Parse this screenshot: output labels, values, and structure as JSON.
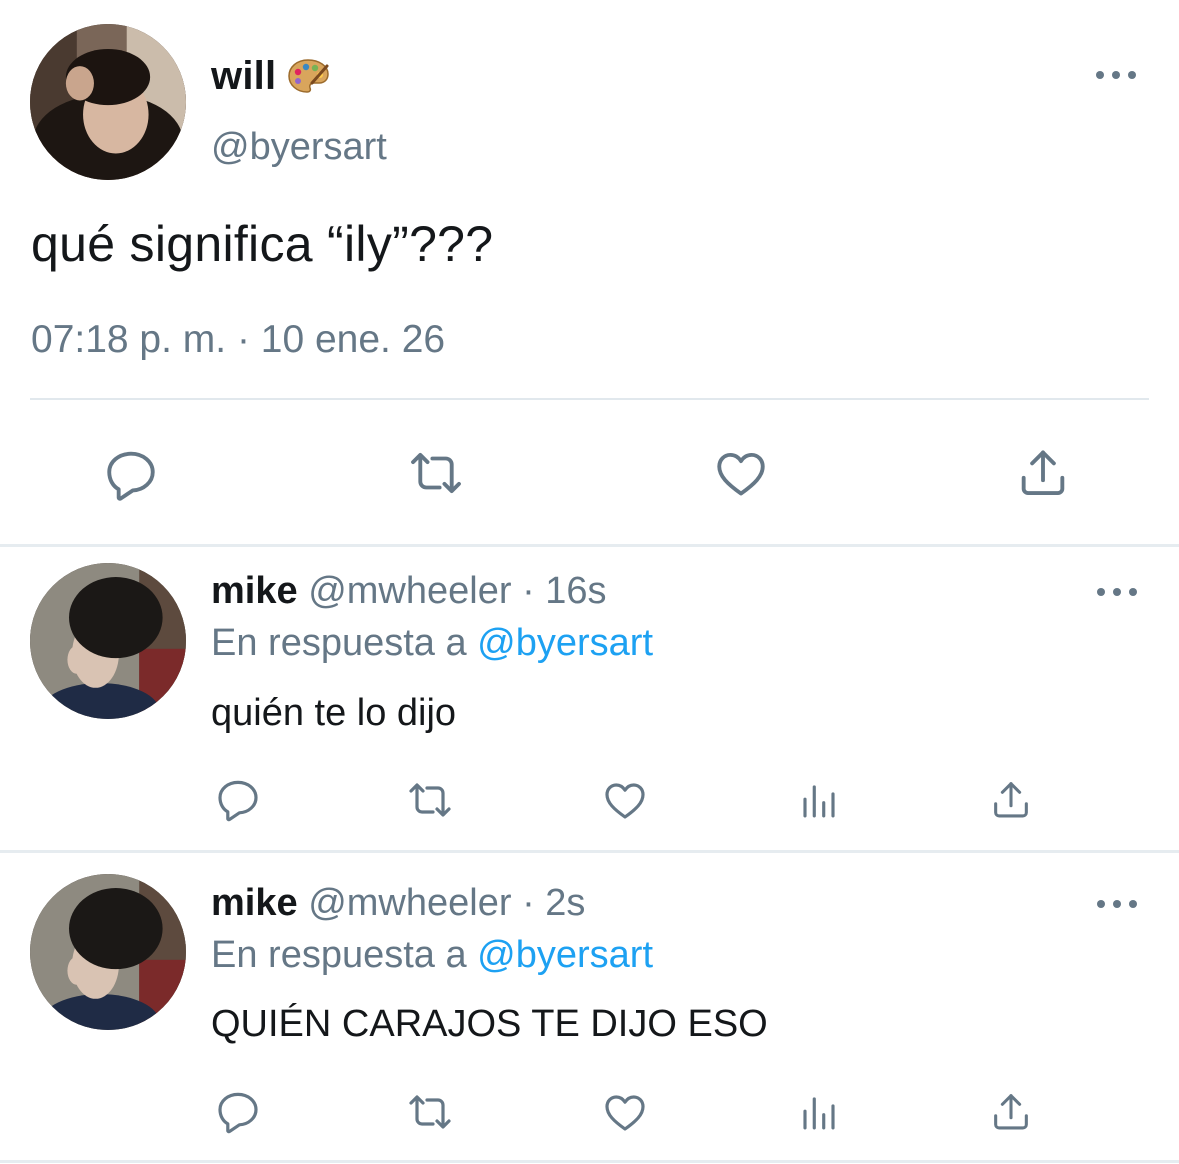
{
  "main_tweet": {
    "name": "will",
    "name_emoji": "palette-icon",
    "handle": "@byersart",
    "text": "qué significa “ily”???",
    "timestamp": "07:18 p. m. · 10 ene. 26",
    "actions": [
      "reply-icon",
      "retweet-icon",
      "like-icon",
      "share-icon"
    ]
  },
  "replies": [
    {
      "name": "mike",
      "handle": "@mwheeler",
      "time": "· 16s",
      "reply_prefix": "En respuesta a",
      "reply_mention": "@byersart",
      "text": "quién te lo dijo",
      "actions": [
        "reply-icon",
        "retweet-icon",
        "like-icon",
        "analytics-icon",
        "share-icon"
      ]
    },
    {
      "name": "mike",
      "handle": "@mwheeler",
      "time": "· 2s",
      "reply_prefix": "En respuesta a",
      "reply_mention": "@byersart",
      "text": "QUIÉN CARAJOS TE DIJO ESO",
      "actions": [
        "reply-icon",
        "retweet-icon",
        "like-icon",
        "analytics-icon",
        "share-icon"
      ]
    }
  ],
  "colors": {
    "text": "#14171a",
    "secondary": "#657786",
    "link": "#1da1f2",
    "divider": "#e6ecf0"
  }
}
